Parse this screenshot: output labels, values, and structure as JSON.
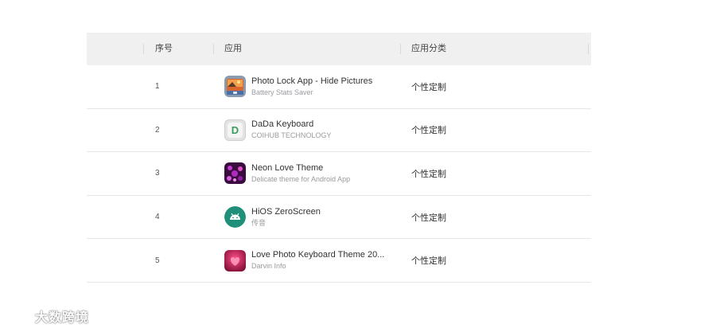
{
  "table": {
    "headers": {
      "index": "序号",
      "app": "应用",
      "category": "应用分类"
    },
    "rows": [
      {
        "index": "1",
        "name": "Photo Lock App - Hide Pictures",
        "developer": "Battery Stats Saver",
        "category": "个性定制",
        "icon": "photo-lock-icon"
      },
      {
        "index": "2",
        "name": "DaDa Keyboard",
        "developer": "COIHUB TECHNOLOGY",
        "category": "个性定制",
        "icon": "dada-keyboard-icon",
        "icon_letter": "D"
      },
      {
        "index": "3",
        "name": "Neon Love Theme",
        "developer": "Delicate theme for Android App",
        "category": "个性定制",
        "icon": "neon-love-theme-icon"
      },
      {
        "index": "4",
        "name": "HiOS ZeroScreen",
        "developer": "传音",
        "category": "个性定制",
        "icon": "android-robot-icon"
      },
      {
        "index": "5",
        "name": "Love Photo Keyboard Theme 20...",
        "developer": "Darvin Info",
        "category": "个性定制",
        "icon": "love-photo-keyboard-icon"
      }
    ]
  },
  "watermark": {
    "text": "大数跨境"
  },
  "colors": {
    "header_bg": "#f0f0f1",
    "row_divider": "#e6e6e8",
    "dada_green": "#3a9a5b",
    "android_teal": "#1f8f7a"
  }
}
